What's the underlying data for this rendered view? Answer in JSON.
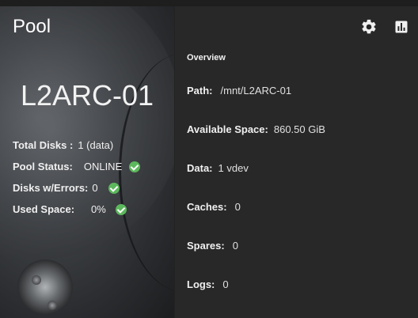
{
  "card": {
    "title": "Pool",
    "pool_name": "L2ARC-01"
  },
  "stats": [
    {
      "label": "Total Disks :",
      "value": "1 (data)",
      "ok": false
    },
    {
      "label": "Pool Status:",
      "value": "ONLINE",
      "ok": true
    },
    {
      "label": "Disks w/Errors:",
      "value": "0",
      "ok": true
    },
    {
      "label": "Used Space:",
      "value": "0%",
      "ok": true
    }
  ],
  "toolbar": {
    "settings_icon": "gear-icon",
    "reports_icon": "bar-chart-icon"
  },
  "overview": {
    "heading": "Overview",
    "rows": [
      {
        "label": "Path:",
        "value": "/mnt/L2ARC-01"
      },
      {
        "label": "Available Space:",
        "value": "860.50 GiB"
      },
      {
        "label": "Data:",
        "value": "1 vdev"
      },
      {
        "label": "Caches:",
        "value": "0"
      },
      {
        "label": "Spares:",
        "value": "0"
      },
      {
        "label": "Logs:",
        "value": "0"
      }
    ]
  },
  "colors": {
    "background": "#282828",
    "ok_green": "#5cb85c"
  }
}
